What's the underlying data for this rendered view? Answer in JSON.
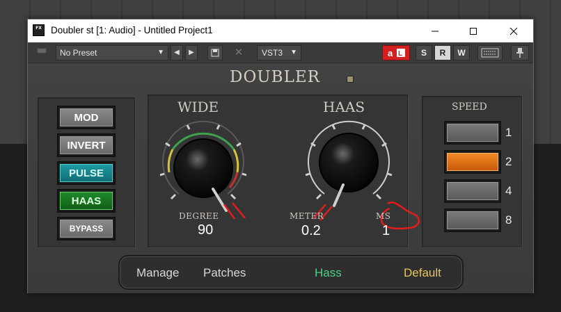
{
  "window": {
    "title": "Doubler st [1: Audio] - Untitled Project1",
    "app_icon_text": "FX"
  },
  "toolbar": {
    "preset": "No Preset",
    "format": "VST3",
    "s_label": "S",
    "r_label": "R",
    "w_label": "W"
  },
  "plugin": {
    "title": "DOUBLER",
    "mode_buttons": [
      "MOD",
      "INVERT",
      "PULSE",
      "HAAS",
      "BYPASS"
    ],
    "wide": {
      "heading": "WIDE",
      "degree_label": "DEGREE",
      "degree_value": "90"
    },
    "haas": {
      "heading": "HAAS",
      "meter_label": "METER",
      "meter_value": "0.2",
      "ms_label": "MS",
      "ms_value": "1"
    },
    "speed": {
      "heading": "SPEED",
      "options": [
        "1",
        "2",
        "4",
        "8"
      ],
      "selected": "2"
    },
    "patch_bar": {
      "manage": "Manage",
      "patches": "Patches",
      "patch_name": "Hass",
      "default": "Default"
    }
  },
  "colors": {
    "accent_orange": "#e87a1f",
    "teal": "#1d9aa2",
    "green": "#1f8a2a",
    "patch_name": "#4fd18a",
    "default_text": "#e8c45a",
    "annotation_red": "#e31c1c"
  }
}
